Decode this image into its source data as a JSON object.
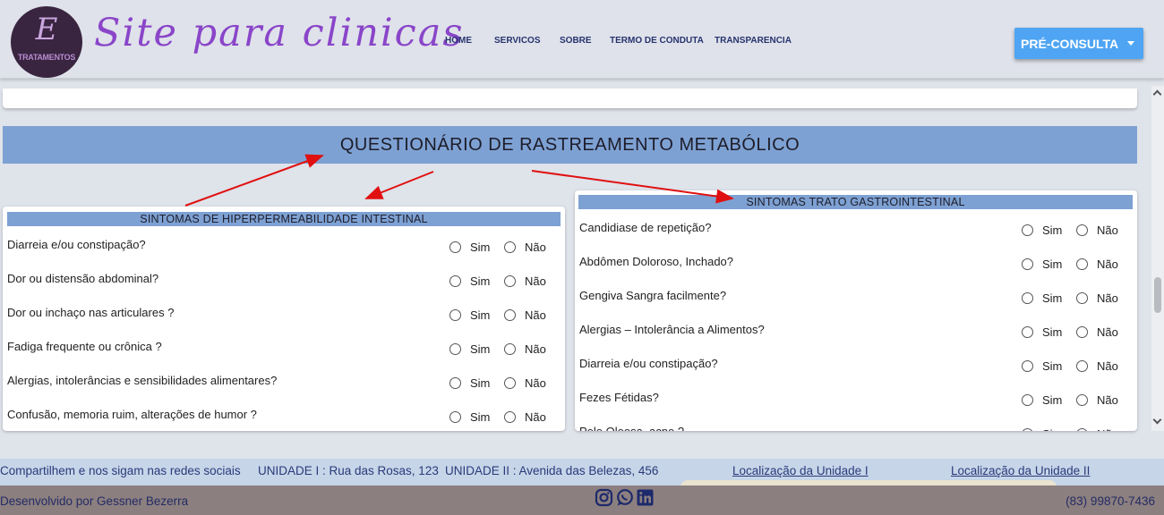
{
  "header": {
    "logo_script": "E",
    "logo_text": "TRATAMENTOS",
    "site_title": "Site para clinicas",
    "nav": [
      "HOME",
      "SERVICOS",
      "SOBRE",
      "TERMO DE CONDUTA",
      "TRANSPARENCIA"
    ],
    "cta_label": "PRÉ-CONSULTA"
  },
  "main": {
    "banner_title": "QUESTIONÁRIO DE RASTREAMENTO METABÓLICO",
    "yes_label": "Sim",
    "no_label": "Não",
    "left_card": {
      "title": "SINTOMAS DE HIPERPERMEABILIDADE INTESTINAL",
      "questions": [
        "Diarreia e/ou constipação?",
        "Dor ou distensão abdominal?",
        "Dor ou inchaço nas articulares ?",
        "Fadiga frequente ou crônica ?",
        "Alergias, intolerâncias e sensibilidades alimentares?",
        "Confusão, memoria ruim, alterações de humor ?"
      ]
    },
    "right_card": {
      "title": "SINTOMAS TRATO GASTROINTESTINAL",
      "questions": [
        "Candidiase de repetição?",
        "Abdômen Doloroso, Inchado?",
        "Gengiva Sangra facilmente?",
        "Alergias – Intolerância a Alimentos?",
        "Diarreia e/ou constipação?",
        "Fezes Fétidas?",
        "Pele Oleosa, acne ?"
      ]
    },
    "annotation_color": "#e01010"
  },
  "footer": {
    "share_text": "Compartilhem e nos sigam nas redes sociais",
    "unit1": "UNIDADE I : Rua das Rosas, 123",
    "unit2": "UNIDADE II : Avenida das Belezas, 456",
    "loc1": "Localização da Unidade I",
    "loc2": "Localização da Unidade II",
    "developer": "Desenvolvido por Gessner Bezerra",
    "phone": "(83) 99870-7436",
    "social_icons": [
      "instagram-icon",
      "whatsapp-icon",
      "linkedin-icon"
    ]
  }
}
